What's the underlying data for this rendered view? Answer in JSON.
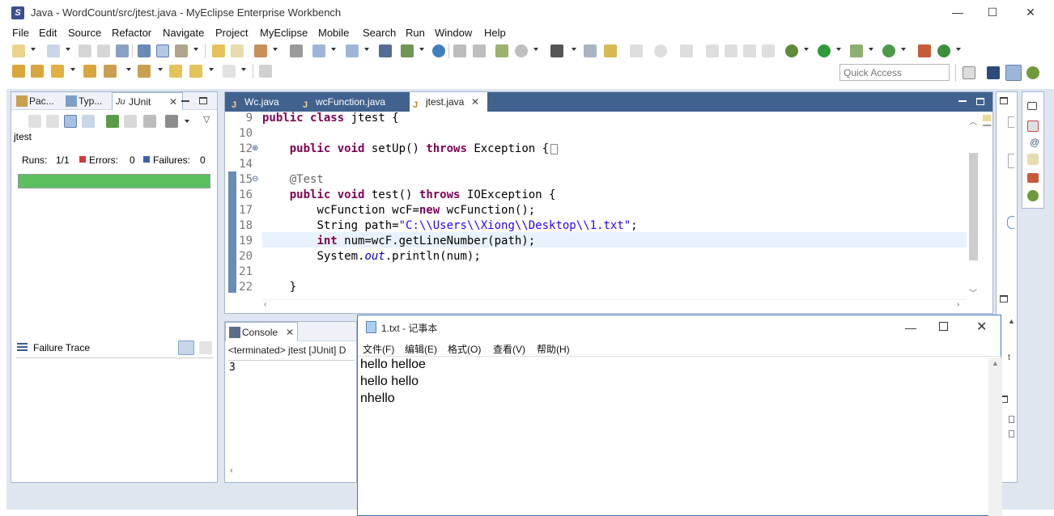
{
  "window": {
    "title": "Java - WordCount/src/jtest.java - MyEclipse Enterprise Workbench",
    "minimize": "—",
    "maximize": "☐",
    "close": "✕"
  },
  "menu": [
    "File",
    "Edit",
    "Source",
    "Refactor",
    "Navigate",
    "Project",
    "MyEclipse",
    "Mobile",
    "Search",
    "Run",
    "Window",
    "Help"
  ],
  "quick_access": {
    "placeholder": "Quick Access"
  },
  "left_panel": {
    "tabs": [
      "Pac...",
      "Typ...",
      "JUnit"
    ],
    "test_name": "jtest",
    "runs_label": "Runs:",
    "runs_value": "1/1",
    "errors_label": "Errors:",
    "errors_value": "0",
    "failures_label": "Failures:",
    "failures_value": "0",
    "progress_color": "#5cbf60",
    "failure_trace": "Failure Trace"
  },
  "editor": {
    "tabs": [
      "Wc.java",
      "wcFunction.java",
      "jtest.java"
    ],
    "active_tab": "jtest.java",
    "lines": [
      {
        "n": "9"
      },
      {
        "n": "10"
      },
      {
        "n": "12"
      },
      {
        "n": "14"
      },
      {
        "n": "15"
      },
      {
        "n": "16"
      },
      {
        "n": "17"
      },
      {
        "n": "18"
      },
      {
        "n": "19"
      },
      {
        "n": "20"
      },
      {
        "n": "21"
      },
      {
        "n": "22"
      }
    ],
    "code": {
      "l9_kw1": "public",
      "l9_kw2": "class",
      "l9_rest": " jtest {",
      "l12_kw1": "public",
      "l12_kw2": "void",
      "l12_mid": " setUp() ",
      "l12_kw3": "throws",
      "l12_rest": " Exception {",
      "l15_ann": "@Test",
      "l16_kw1": "public",
      "l16_kw2": "void",
      "l16_mid": " test() ",
      "l16_kw3": "throws",
      "l16_rest": " IOException {",
      "l17_a": "wcFunction wcF=",
      "l17_kw": "new",
      "l17_b": " wcFunction();",
      "l18_a": "String path=",
      "l18_str": "\"C:\\\\Users\\\\Xiong\\\\Desktop\\\\1.txt\"",
      "l18_b": ";",
      "l19_kw": "int",
      "l19_b": " num=wcF.getLineNumber(path);",
      "l20_a": "System.",
      "l20_it": "out",
      "l20_b": ".println(num);",
      "l22": "}"
    }
  },
  "console": {
    "tab": "Console",
    "header": "<terminated> jtest [JUnit] D",
    "output": "3"
  },
  "notepad": {
    "title": "1.txt - 记事本",
    "menu": [
      "文件(F)",
      "编辑(E)",
      "格式(O)",
      "查看(V)",
      "帮助(H)"
    ],
    "text": "hello helloe\nhello hello\nnhello"
  }
}
